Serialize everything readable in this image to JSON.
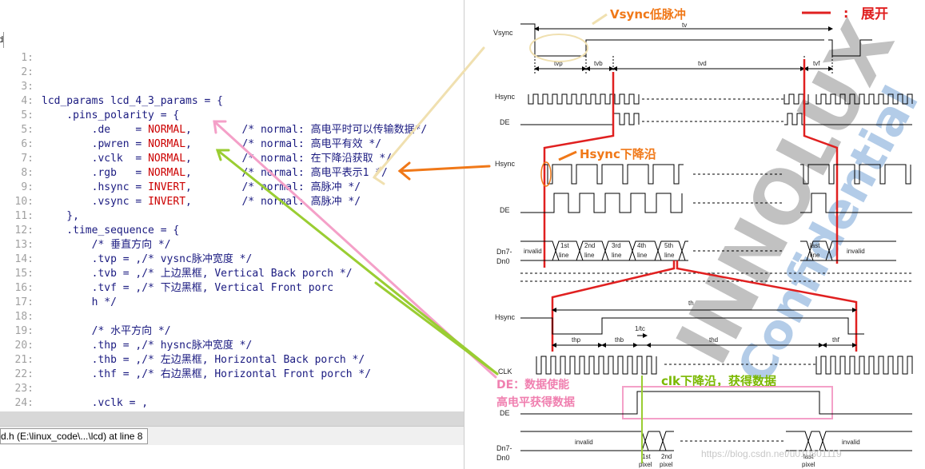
{
  "editor": {
    "left_marker": "d",
    "lines": [
      {
        "num": "1:",
        "parts": []
      },
      {
        "num": "2:",
        "parts": []
      },
      {
        "num": "3:",
        "parts": []
      },
      {
        "num": "4:",
        "parts": [
          {
            "t": "lcd_params lcd_4_3_params = {"
          }
        ]
      },
      {
        "num": "5:",
        "parts": [
          {
            "t": "    .pins_polarity = {"
          }
        ]
      },
      {
        "num": "5:",
        "parts": [
          {
            "t": "        .de    = "
          },
          {
            "t": "NORMAL",
            "kw": true
          },
          {
            "t": ",        /* normal: 高电平时可以传输数据*/"
          }
        ]
      },
      {
        "num": "6:",
        "parts": [
          {
            "t": "        .pwren = "
          },
          {
            "t": "NORMAL",
            "kw": true
          },
          {
            "t": ",        /* normal: 高电平有效 */"
          }
        ]
      },
      {
        "num": "7:",
        "parts": [
          {
            "t": "        .vclk  = "
          },
          {
            "t": "NORMAL",
            "kw": true
          },
          {
            "t": ",        /* normal: 在下降沿获取 */"
          }
        ]
      },
      {
        "num": "8:",
        "parts": [
          {
            "t": "        .rgb   = "
          },
          {
            "t": "NORMAL",
            "kw": true
          },
          {
            "t": ",        /* normal: 高电平表示1 */"
          }
        ]
      },
      {
        "num": "9:",
        "parts": [
          {
            "t": "        .hsync = "
          },
          {
            "t": "INVERT",
            "kw": true
          },
          {
            "t": ",        /* normal: 高脉冲 */"
          }
        ]
      },
      {
        "num": "10:",
        "parts": [
          {
            "t": "        .vsync = "
          },
          {
            "t": "INVERT",
            "kw": true
          },
          {
            "t": ",        /* normal: 高脉冲 */"
          }
        ]
      },
      {
        "num": "11:",
        "parts": [
          {
            "t": "    },"
          }
        ]
      },
      {
        "num": "12:",
        "parts": [
          {
            "t": "    .time_sequence = {"
          }
        ]
      },
      {
        "num": "13:",
        "parts": [
          {
            "t": "        /* 垂直方向 */"
          }
        ]
      },
      {
        "num": "14:",
        "parts": [
          {
            "t": "        .tvp = ,/* vysnc脉冲宽度 */"
          }
        ]
      },
      {
        "num": "15:",
        "parts": [
          {
            "t": "        .tvb = ,/* 上边黑框, Vertical Back porch */"
          }
        ]
      },
      {
        "num": "16:",
        "parts": [
          {
            "t": "        .tvf = ,/* 下边黑框, Vertical Front porc"
          }
        ]
      },
      {
        "num": "17:",
        "parts": [
          {
            "t": "        h */"
          }
        ]
      },
      {
        "num": "18:",
        "parts": []
      },
      {
        "num": "19:",
        "parts": [
          {
            "t": "        /* 水平方向 */"
          }
        ]
      },
      {
        "num": "20:",
        "parts": [
          {
            "t": "        .thp = ,/* hysnc脉冲宽度 */"
          }
        ]
      },
      {
        "num": "21:",
        "parts": [
          {
            "t": "        .thb = ,/* 左边黑框, Horizontal Back porch */"
          }
        ]
      },
      {
        "num": "22:",
        "parts": [
          {
            "t": "        .thf = ,/* 右边黑框, Horizontal Front porch */"
          }
        ]
      },
      {
        "num": "23:",
        "parts": []
      },
      {
        "num": "24:",
        "parts": [
          {
            "t": "        .vclk = ,"
          }
        ]
      },
      {
        "num": "25:",
        "parts": [
          {
            "t": "    },"
          }
        ]
      }
    ],
    "status_tab": "d.h (E:\\linux_code\\...\\lcd) at line 8"
  },
  "diagram": {
    "signals": {
      "vsync": "Vsync",
      "hsync1": "Hsync",
      "de1": "DE",
      "hsync2": "Hsync",
      "de2": "DE",
      "dn1a": "Dn7-",
      "dn1b": "Dn0",
      "hsync3": "Hsync",
      "clk": "CLK",
      "de3": "DE",
      "dn2a": "Dn7-",
      "dn2b": "Dn0"
    },
    "timing": {
      "tv": "tv",
      "tvp": "tvp",
      "tvb": "tvb",
      "tvd": "tvd",
      "tvf": "tvf",
      "th": "th",
      "thp": "thp",
      "thb": "thb",
      "thd": "thd",
      "thf": "thf",
      "one_tc": "1/tc"
    },
    "data_cells_top": [
      "invalid",
      "1st line",
      "2nd line",
      "3rd line",
      "4th line",
      "5th line",
      "last line",
      "invalid"
    ],
    "data_cells_bottom": [
      "invalid",
      "1st pixel",
      "2nd pixel",
      "last pixel",
      "invalid"
    ],
    "annotations": {
      "vsync_low": "Vsync低脉冲",
      "expand_marker": "—— :",
      "expand": "展开",
      "hsync_fall": "Hsync下降沿",
      "clk_fall": "clk下降沿，获得数据",
      "de_enable": "DE：数据使能",
      "de_high": "高电平获得数据"
    },
    "watermark": {
      "word1": "INNOLUX",
      "word2": "Confidential"
    },
    "footer_watermark": "https://blog.csdn.net/u010801119",
    "colors": {
      "red": "#e02020",
      "orange": "#f07818",
      "green": "#9acd32",
      "pink": "#f4a0c8",
      "tan": "#f0e0b0"
    }
  }
}
